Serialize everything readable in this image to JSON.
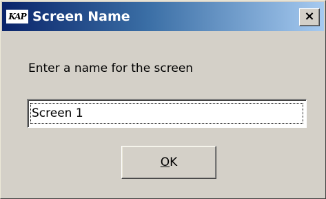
{
  "window": {
    "title": "Screen Name",
    "logo_text": "KAP",
    "close_symbol": "×"
  },
  "dialog": {
    "prompt": "Enter a name for the screen",
    "name_field_value": "Screen 1",
    "ok_mnemonic": "O",
    "ok_rest": "K"
  },
  "colors": {
    "titlebar_start": "#0a246a",
    "titlebar_end": "#a6caf0",
    "face": "#d4d0c8"
  },
  "icons": {
    "app": "kap-logo-icon",
    "close": "close-icon"
  }
}
